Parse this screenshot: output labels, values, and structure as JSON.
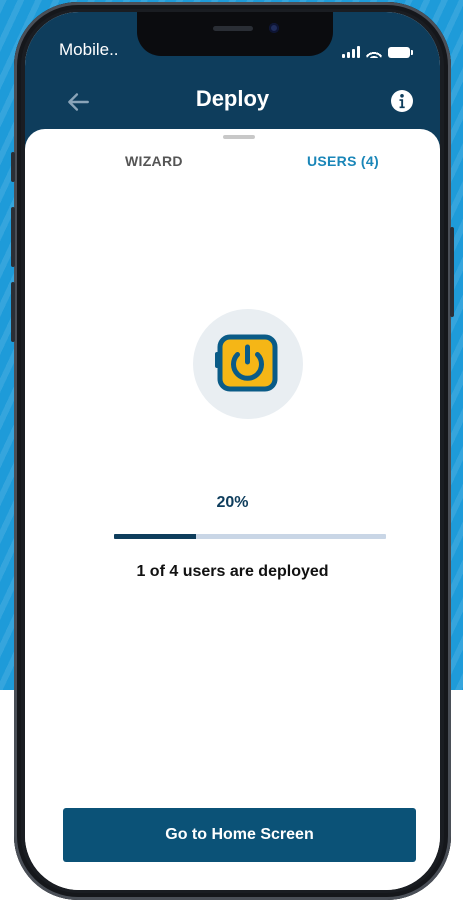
{
  "status_bar": {
    "carrier": "Mobile.."
  },
  "header": {
    "title": "Deploy",
    "back_icon": "arrow-left-icon",
    "info_icon": "info-icon"
  },
  "tabs": [
    {
      "label": "WIZARD",
      "active": false
    },
    {
      "label": "USERS (4)",
      "active": true
    }
  ],
  "deploy_status": {
    "icon": "device-power-icon",
    "percent_label": "20%",
    "progress": 0.3,
    "message": "1 of 4 users are deployed"
  },
  "actions": {
    "home_label": "Go to Home Screen"
  },
  "colors": {
    "header_bg": "#0e3d5c",
    "accent": "#1a86b8",
    "button_bg": "#0b5277",
    "device_fill": "#f5b616",
    "device_stroke": "#0a5b87",
    "backdrop": "#1e9bd9"
  }
}
